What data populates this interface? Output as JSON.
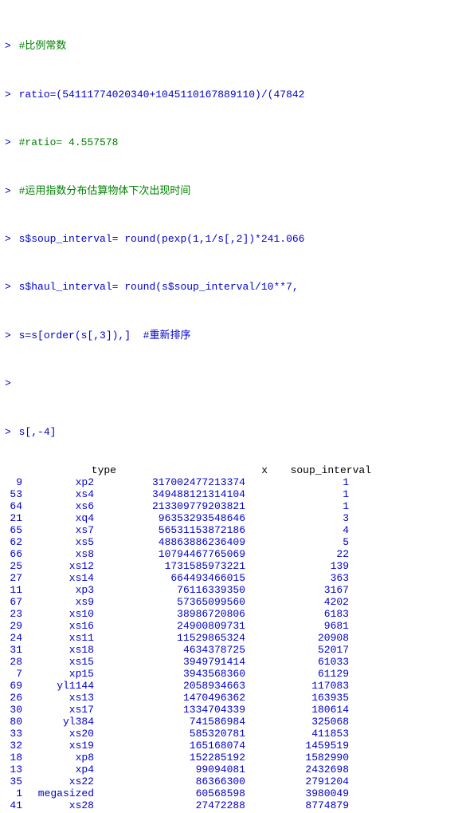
{
  "console": {
    "lines": [
      {
        "type": "comment",
        "prompt": ">",
        "text": " #比例常数"
      },
      {
        "type": "code",
        "prompt": ">",
        "text": " ratio=(54111774020340+1045110167889110)/(47842"
      },
      {
        "type": "comment",
        "prompt": ">",
        "text": " #ratio= 4.557578"
      },
      {
        "type": "comment",
        "prompt": ">",
        "text": " #运用指数分布估算物体下次出现时间"
      },
      {
        "type": "code",
        "prompt": ">",
        "text": " s$soup_interval= round(pexp(1,1/s[,2])*241.066"
      },
      {
        "type": "code",
        "prompt": ">",
        "text": " s$haul_interval= round(s$soup_interval/10**7,"
      },
      {
        "type": "code",
        "prompt": ">",
        "text": " s=s[order(s[,3]),]  #重新排序"
      },
      {
        "type": "empty",
        "prompt": ">",
        "text": ""
      },
      {
        "type": "code",
        "prompt": ">",
        "text": " s[,-4]"
      }
    ],
    "table": {
      "headers": [
        "type",
        "x",
        "soup_interval"
      ],
      "rows": [
        {
          "rownum": "9",
          "type": "xp2",
          "x": "317002477213374",
          "soup": "1"
        },
        {
          "rownum": "53",
          "type": "xs4",
          "x": "349488121314104",
          "soup": "1"
        },
        {
          "rownum": "64",
          "type": "xs6",
          "x": "213309779203821",
          "soup": "1"
        },
        {
          "rownum": "21",
          "type": "xq4",
          "x": "96353293548646",
          "soup": "3"
        },
        {
          "rownum": "65",
          "type": "xs7",
          "x": "56531153872186",
          "soup": "4"
        },
        {
          "rownum": "62",
          "type": "xs5",
          "x": "48863886236409",
          "soup": "5"
        },
        {
          "rownum": "66",
          "type": "xs8",
          "x": "10794467765069",
          "soup": "22"
        },
        {
          "rownum": "25",
          "type": "xs12",
          "x": "1731585973221",
          "soup": "139"
        },
        {
          "rownum": "27",
          "type": "xs14",
          "x": "664493466015",
          "soup": "363"
        },
        {
          "rownum": "11",
          "type": "xp3",
          "x": "76116339350",
          "soup": "3167"
        },
        {
          "rownum": "67",
          "type": "xs9",
          "x": "57365099560",
          "soup": "4202"
        },
        {
          "rownum": "23",
          "type": "xs10",
          "x": "38986720806",
          "soup": "6183"
        },
        {
          "rownum": "29",
          "type": "xs16",
          "x": "24900809731",
          "soup": "9681"
        },
        {
          "rownum": "24",
          "type": "xs11",
          "x": "11529865324",
          "soup": "20908"
        },
        {
          "rownum": "31",
          "type": "xs18",
          "x": "4634378725",
          "soup": "52017"
        },
        {
          "rownum": "28",
          "type": "xs15",
          "x": "3949791414",
          "soup": "61033"
        },
        {
          "rownum": "7",
          "type": "xp15",
          "x": "3943568360",
          "soup": "61129"
        },
        {
          "rownum": "69",
          "type": "yl1144",
          "x": "2058934663",
          "soup": "117083"
        },
        {
          "rownum": "26",
          "type": "xs13",
          "x": "1470496362",
          "soup": "163935"
        },
        {
          "rownum": "30",
          "type": "xs17",
          "x": "1334704339",
          "soup": "180614"
        },
        {
          "rownum": "80",
          "type": "yl384",
          "x": "741586984",
          "soup": "325068"
        },
        {
          "rownum": "33",
          "type": "xs20",
          "x": "585320781",
          "soup": "411853"
        },
        {
          "rownum": "32",
          "type": "xs19",
          "x": "165168074",
          "soup": "1459519"
        },
        {
          "rownum": "18",
          "type": "xp8",
          "x": "152285192",
          "soup": "1582990"
        },
        {
          "rownum": "13",
          "type": "xp4",
          "x": "99094081",
          "soup": "2432698"
        },
        {
          "rownum": "35",
          "type": "xs22",
          "x": "86366300",
          "soup": "2791204"
        },
        {
          "rownum": "1",
          "type": "megasized",
          "x": "60568598",
          "soup": "3980049"
        },
        {
          "rownum": "41",
          "type": "xs28",
          "x": "27472288",
          "soup": "8774879"
        }
      ]
    }
  }
}
